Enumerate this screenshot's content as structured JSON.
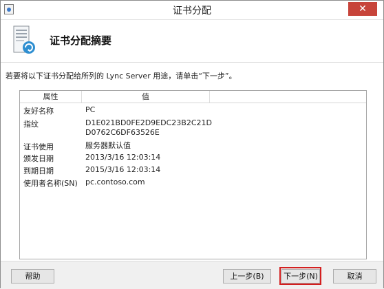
{
  "window": {
    "title": "证书分配",
    "close_glyph": "✕"
  },
  "header": {
    "title": "证书分配摘要"
  },
  "instruction": "若要将以下证书分配给所列的 Lync Server 用途，请单击“下一步”。",
  "table": {
    "columns": [
      "属性",
      "值",
      ""
    ],
    "rows": [
      {
        "label": "友好名称",
        "value": "PC"
      },
      {
        "label": "指纹",
        "value": "D1E021BD0FE2D9EDC23B2C21D D0762C6DF63526E"
      },
      {
        "label": "证书使用",
        "value": "服务器默认值"
      },
      {
        "label": "颁发日期",
        "value": "2013/3/16 12:03:14"
      },
      {
        "label": "到期日期",
        "value": "2015/3/16 12:03:14"
      },
      {
        "label": "使用者名称(SN)",
        "value": "pc.contoso.com"
      }
    ]
  },
  "buttons": {
    "help": "帮助",
    "back": "上一步(B)",
    "next": "下一步(N)",
    "cancel": "取消"
  },
  "colors": {
    "close_button": "#c7443a",
    "highlight": "#d31f1f",
    "icon_accent": "#2f8fd1"
  },
  "icons": [
    "app-icon",
    "certificate-wizard-icon",
    "close-icon"
  ]
}
